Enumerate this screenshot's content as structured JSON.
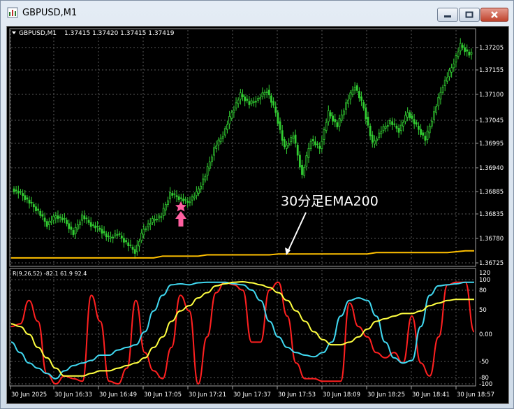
{
  "window": {
    "title": "GBPUSD,M1"
  },
  "chart_header": {
    "symbol_tf": "GBPUSD,M1",
    "ohlc": "1.37415 1.37420 1.37415 1.37419"
  },
  "annotation": {
    "text": "30分足EMA200"
  },
  "indicator": {
    "label": "R(9,26,52) -82.1 61.9 92.4"
  },
  "colors": {
    "bull_candle": "#32cd32",
    "ema200": "#ffc000",
    "line_red": "#ff2020",
    "line_cyan": "#40d8f0",
    "line_yellow": "#ffff40",
    "signal": "#ff5fa0"
  },
  "chart_data": [
    {
      "type": "line",
      "title": "",
      "y_ticks": [
        "1.37205",
        "1.37155",
        "1.37100",
        "1.37045",
        "1.36995",
        "1.36940",
        "1.36885",
        "1.36835",
        "1.36780",
        "1.36725"
      ],
      "x_ticks": [
        "30 Jun 2025",
        "30 Jun 16:33",
        "30 Jun 16:49",
        "30 Jun 17:05",
        "30 Jun 17:21",
        "30 Jun 17:37",
        "30 Jun 17:53",
        "30 Jun 18:09",
        "30 Jun 18:25",
        "30 Jun 18:41",
        "30 Jun 18:57"
      ],
      "ylim": [
        1.367,
        1.3725
      ],
      "series": [
        {
          "values": [
            1.3689,
            1.3688,
            1.3686,
            1.3684,
            1.3681,
            1.3683,
            1.3682,
            1.3679,
            1.3683,
            1.3681,
            1.368,
            1.3678,
            1.3679,
            1.3677,
            1.3675,
            1.368,
            1.3682,
            1.3683,
            1.3688,
            1.3687,
            1.3686,
            1.3688,
            1.3692,
            1.3698,
            1.3701,
            1.3706,
            1.371,
            1.3708,
            1.3709,
            1.3711,
            1.3706,
            1.3698,
            1.3701,
            1.3692,
            1.37,
            1.3698,
            1.3706,
            1.3703,
            1.3708,
            1.3712,
            1.3707,
            1.3699,
            1.3702,
            1.3704,
            1.3702,
            1.3706,
            1.3703,
            1.37,
            1.3706,
            1.3712,
            1.3716,
            1.3721,
            1.3719
          ]
        },
        {
          "name": "30分足EMA200",
          "values": [
            1.36736,
            1.36736,
            1.36736,
            1.36736,
            1.36736,
            1.36736,
            1.36736,
            1.36736,
            1.36736,
            1.36736,
            1.36736,
            1.36736,
            1.36736,
            1.36736,
            1.36736,
            1.36736,
            1.36736,
            1.3674,
            1.3674,
            1.3674,
            1.3674,
            1.3674,
            1.36743,
            1.36743,
            1.36743,
            1.36743,
            1.36743,
            1.36743,
            1.36743,
            1.36743,
            1.36745,
            1.36745,
            1.36745,
            1.36745,
            1.36745,
            1.36745,
            1.36745,
            1.36745,
            1.36745,
            1.36745,
            1.36745,
            1.36748,
            1.36748,
            1.36748,
            1.36748,
            1.36748,
            1.36748,
            1.36748,
            1.36748,
            1.36748,
            1.3675,
            1.36752,
            1.36752
          ]
        }
      ]
    },
    {
      "type": "line",
      "title": "",
      "y_ticks": [
        "120",
        "100",
        "80",
        "50",
        "0.00",
        "-50",
        "-80",
        "-100"
      ],
      "ylim": [
        -105,
        125
      ],
      "series": [
        {
          "values": [
            10,
            15,
            60,
            20,
            -80,
            -100,
            -85,
            -90,
            -95,
            70,
            20,
            -95,
            -100,
            -70,
            60,
            -40,
            -75,
            -90,
            -30,
            70,
            40,
            -100,
            -10,
            75,
            95,
            90,
            80,
            -20,
            -20,
            80,
            95,
            30,
            -60,
            -90,
            -90,
            -95,
            -95,
            -95,
            55,
            10,
            -10,
            -40,
            -50,
            -40,
            -60,
            30,
            -60,
            -85,
            -10,
            90,
            95,
            95,
            0
          ]
        },
        {
          "values": [
            -20,
            -40,
            -60,
            -70,
            -80,
            -90,
            -75,
            -65,
            -60,
            -55,
            -45,
            -45,
            -35,
            -30,
            -25,
            0,
            40,
            70,
            90,
            92,
            90,
            94,
            95,
            95,
            95,
            92,
            90,
            80,
            60,
            20,
            -10,
            -30,
            -40,
            -45,
            -48,
            -40,
            -20,
            30,
            60,
            65,
            60,
            30,
            -20,
            -50,
            -60,
            -55,
            10,
            70,
            88,
            90,
            92,
            95,
            95
          ]
        },
        {
          "values": [
            15,
            10,
            -5,
            -30,
            -50,
            -70,
            -85,
            -85,
            -85,
            -80,
            -75,
            -75,
            -70,
            -65,
            -60,
            -50,
            -30,
            -10,
            20,
            40,
            50,
            65,
            75,
            88,
            92,
            95,
            96,
            94,
            90,
            85,
            75,
            60,
            40,
            20,
            0,
            -15,
            -25,
            -25,
            -20,
            -10,
            5,
            20,
            25,
            30,
            35,
            35,
            40,
            50,
            55,
            60,
            62,
            62,
            62
          ]
        }
      ]
    }
  ]
}
